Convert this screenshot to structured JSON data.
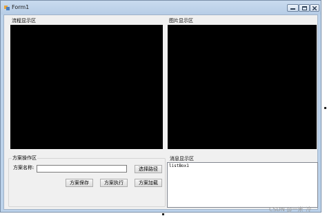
{
  "window": {
    "title": "Form1",
    "controls": {
      "minimize": "minimize",
      "maximize": "maximize",
      "close": "close"
    }
  },
  "flow_panel": {
    "label": "流程显示区"
  },
  "image_panel": {
    "label": "图片显示区"
  },
  "scheme_group": {
    "label": "方案操作区",
    "name_label": "方案名称:",
    "name_value": "",
    "select_path_button": "选择路径",
    "save_button": "方案保存",
    "execute_button": "方案执行",
    "load_button": "方案加载"
  },
  "message_group": {
    "label": "消息显示区",
    "list_items": [
      "listBox1"
    ]
  },
  "watermark": "CSDN @一米_冷"
}
